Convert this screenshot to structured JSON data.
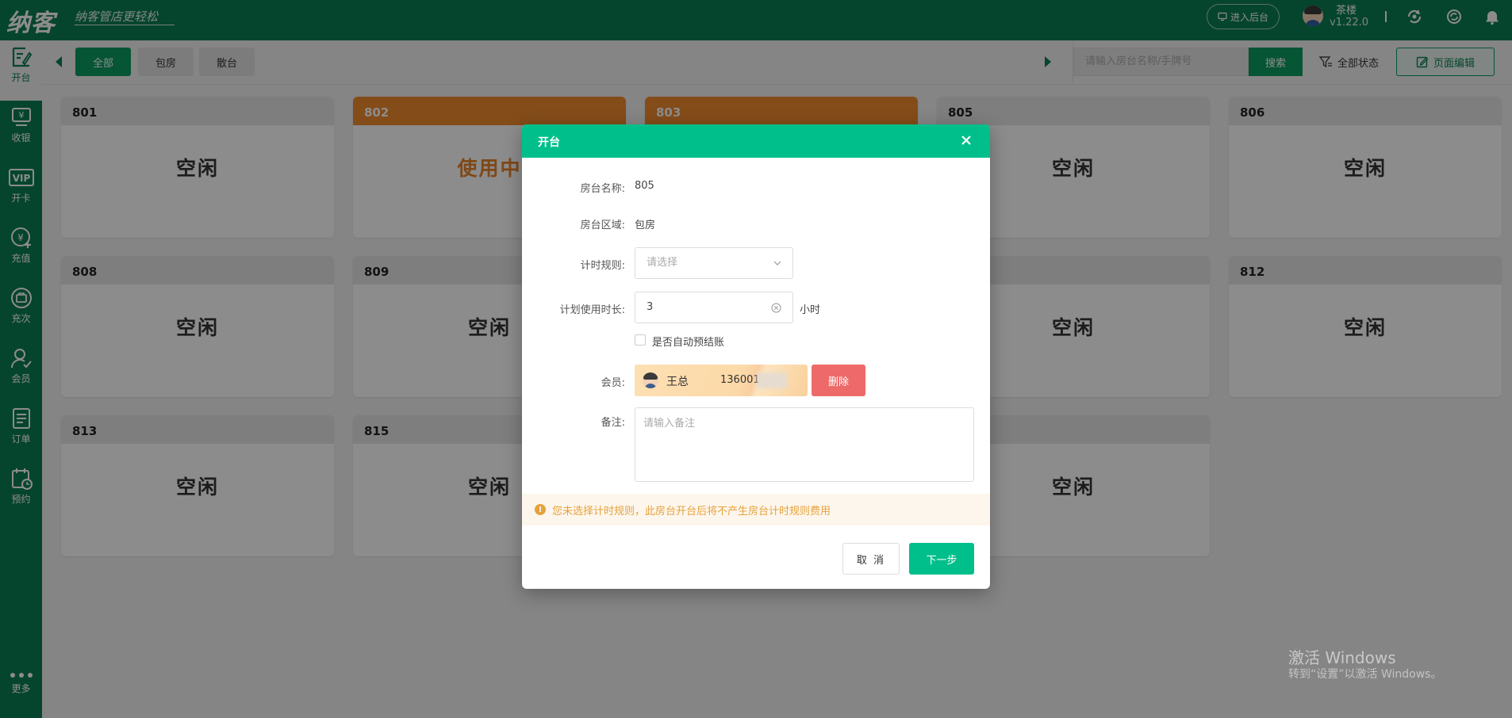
{
  "topbar": {
    "logo": "纳客",
    "slogan": "纳客管店更轻松",
    "backend_label": "进入后台",
    "user_name": "茶楼",
    "version": "v1.22.0",
    "icons": [
      "sync-icon",
      "refresh-icon",
      "bell-icon"
    ]
  },
  "sidebar": {
    "items": [
      {
        "label": "开台",
        "icon": "open-table-icon"
      },
      {
        "label": "收银",
        "icon": "cashier-icon"
      },
      {
        "label": "开卡",
        "icon": "vip-card-icon"
      },
      {
        "label": "充值",
        "icon": "recharge-icon"
      },
      {
        "label": "充次",
        "icon": "recharge-times-icon"
      },
      {
        "label": "会员",
        "icon": "member-icon"
      },
      {
        "label": "订单",
        "icon": "order-icon"
      },
      {
        "label": "预约",
        "icon": "reservation-icon"
      }
    ],
    "more_label": "更多"
  },
  "toolbar": {
    "tabs": [
      {
        "label": "全部",
        "active": true
      },
      {
        "label": "包房",
        "active": false
      },
      {
        "label": "散台",
        "active": false
      }
    ],
    "search_placeholder": "请输入房台名称/手牌号",
    "search_button": "搜索",
    "status_filter": "全部状态",
    "page_edit": "页面编辑"
  },
  "rooms": [
    {
      "name": "801",
      "status": "空闲",
      "busy": false
    },
    {
      "name": "802",
      "status": "使用中",
      "busy": true
    },
    {
      "name": "803",
      "status": "",
      "busy": true
    },
    {
      "name": "805",
      "status": "空闲",
      "busy": false
    },
    {
      "name": "806",
      "status": "空闲",
      "busy": false
    },
    {
      "name": "808",
      "status": "空闲",
      "busy": false
    },
    {
      "name": "809",
      "status": "空闲",
      "busy": false
    },
    {
      "name": "",
      "status": "",
      "busy": false
    },
    {
      "name": "",
      "status": "空闲",
      "busy": false
    },
    {
      "name": "812",
      "status": "空闲",
      "busy": false
    },
    {
      "name": "813",
      "status": "空闲",
      "busy": false
    },
    {
      "name": "815",
      "status": "空闲",
      "busy": false
    },
    {
      "name": "",
      "status": "",
      "busy": false
    },
    {
      "name": "",
      "status": "空闲",
      "busy": false
    }
  ],
  "modal": {
    "title": "开台",
    "room_name_label": "房台名称:",
    "room_name": "805",
    "room_area_label": "房台区域:",
    "room_area": "包房",
    "timing_rule_label": "计时规则:",
    "timing_rule_placeholder": "请选择",
    "duration_label": "计划使用时长:",
    "duration_value": "3",
    "duration_unit": "小时",
    "auto_checkout_label": "是否自动预结账",
    "member_label": "会员:",
    "member_name": "王总",
    "member_phone": "136001",
    "delete_label": "删除",
    "remark_label": "备注:",
    "remark_placeholder": "请输入备注",
    "warning": "您未选择计时规则，此房台开台后将不产生房台计时规则费用",
    "cancel_label": "取 消",
    "next_label": "下一步"
  },
  "watermark": {
    "title": "激活 Windows",
    "subtitle": "转到“设置”以激活 Windows。"
  }
}
